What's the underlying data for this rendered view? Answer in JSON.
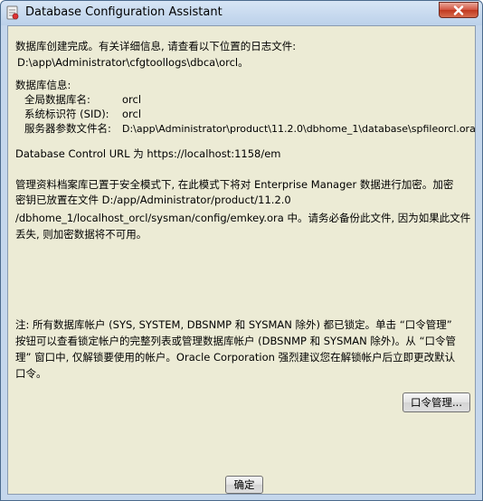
{
  "window": {
    "title": "Database Configuration Assistant",
    "icon": "dbca-app-icon",
    "close_icon": "close-x-icon"
  },
  "content": {
    "created_line": "数据库创建完成。有关详细信息, 请查看以下位置的日志文件:",
    "log_path": "D:\\app\\Administrator\\cfgtoollogs\\dbca\\orcl。",
    "db_info_heading": "数据库信息:",
    "info_rows": [
      {
        "label": "全局数据库名:",
        "value": "orcl"
      },
      {
        "label": "系统标识符 (SID):",
        "value": "orcl"
      },
      {
        "label": "服务器参数文件名:",
        "value": "D:\\app\\Administrator\\product\\11.2.0\\dbhome_1\\database\\spfileorcl.ora"
      }
    ],
    "dbcontrol_line": "Database Control URL 为 https://localhost:1158/em",
    "key_lines": [
      "管理资料档案库已置于安全模式下, 在此模式下将对 Enterprise Manager 数据进行加密。加密",
      "密钥已放置在文件 D:/app/Administrator/product/11.2.0",
      "/dbhome_1/localhost_orcl/sysman/config/emkey.ora 中。请务必备份此文件, 因为如果此文件",
      "丢失, 则加密数据将不可用。"
    ],
    "note_lines": [
      "注: 所有数据库帐户 (SYS, SYSTEM, DBSNMP 和 SYSMAN 除外) 都已锁定。单击 “口令管理”",
      "按钮可以查看锁定帐户的完整列表或管理数据库帐户 (DBSNMP 和 SYSMAN 除外)。从 “口令管",
      "理” 窗口中, 仅解锁要使用的帐户。Oracle Corporation 强烈建议您在解锁帐户后立即更改默认",
      "口令。"
    ]
  },
  "buttons": {
    "password_management": "口令管理...",
    "ok": "确定"
  },
  "colors": {
    "client_bg": "#ecebd5",
    "frame": "#c5d7ec",
    "close_red": "#c0391f"
  }
}
